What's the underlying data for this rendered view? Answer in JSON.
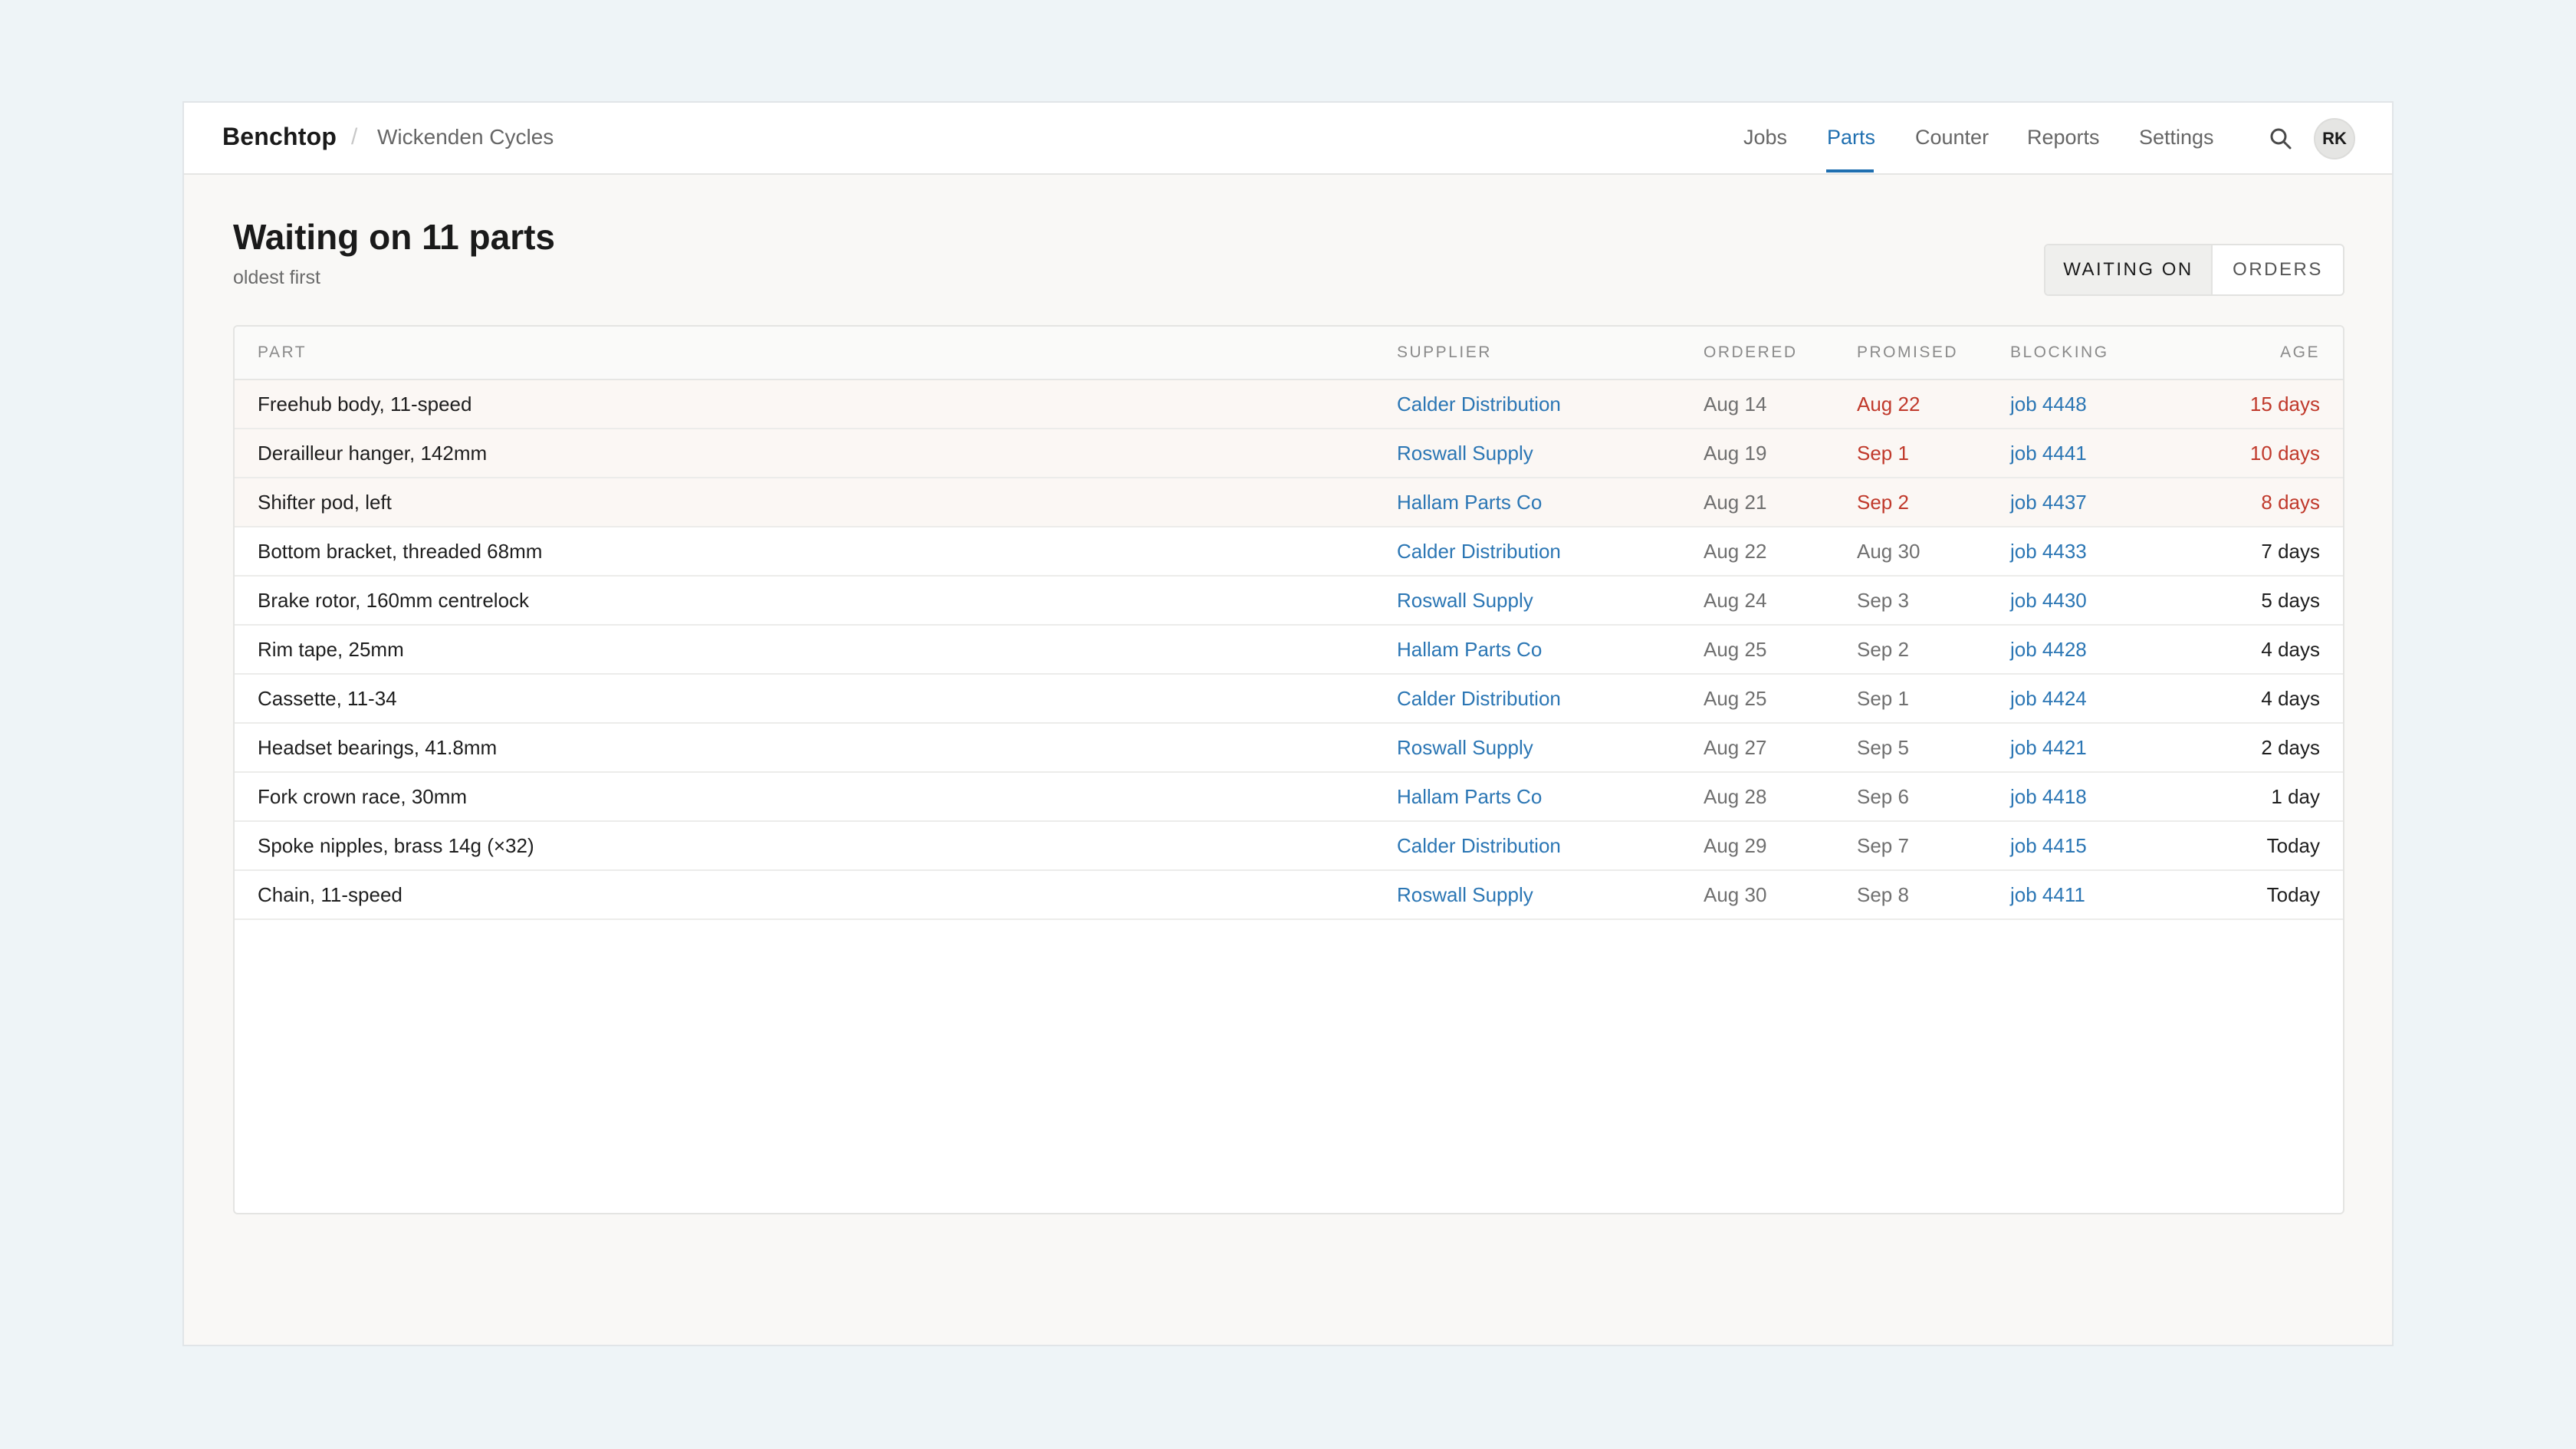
{
  "app": {
    "brand": "Benchtop",
    "separator": "/",
    "shop": "Wickenden Cycles"
  },
  "nav": {
    "items": [
      {
        "label": "Jobs"
      },
      {
        "label": "Parts",
        "active": true
      },
      {
        "label": "Counter"
      },
      {
        "label": "Reports"
      },
      {
        "label": "Settings"
      }
    ],
    "search_icon": "search-icon",
    "avatar_initials": "RK"
  },
  "page": {
    "title": "Waiting on 11 parts",
    "subtitle": "oldest first"
  },
  "view_toggle": {
    "selected": "WAITING ON",
    "options": [
      "WAITING ON",
      "ORDERS"
    ]
  },
  "table": {
    "columns": [
      "PART",
      "SUPPLIER",
      "ORDERED",
      "PROMISED",
      "BLOCKING",
      "AGE"
    ],
    "rows": [
      {
        "part": "Freehub body, 11-speed",
        "supplier": "Calder Distribution",
        "ordered": "Aug 14",
        "promised": "Aug 22",
        "blocking": "job 4448",
        "age": "15 days",
        "overdue": true
      },
      {
        "part": "Derailleur hanger, 142mm",
        "supplier": "Roswall Supply",
        "ordered": "Aug 19",
        "promised": "Sep 1",
        "blocking": "job 4441",
        "age": "10 days",
        "overdue": true
      },
      {
        "part": "Shifter pod, left",
        "supplier": "Hallam Parts Co",
        "ordered": "Aug 21",
        "promised": "Sep 2",
        "blocking": "job 4437",
        "age": "8 days",
        "overdue": true
      },
      {
        "part": "Bottom bracket, threaded 68mm",
        "supplier": "Calder Distribution",
        "ordered": "Aug 22",
        "promised": "Aug 30",
        "blocking": "job 4433",
        "age": "7 days",
        "overdue": false
      },
      {
        "part": "Brake rotor, 160mm centrelock",
        "supplier": "Roswall Supply",
        "ordered": "Aug 24",
        "promised": "Sep 3",
        "blocking": "job 4430",
        "age": "5 days",
        "overdue": false
      },
      {
        "part": "Rim tape, 25mm",
        "supplier": "Hallam Parts Co",
        "ordered": "Aug 25",
        "promised": "Sep 2",
        "blocking": "job 4428",
        "age": "4 days",
        "overdue": false
      },
      {
        "part": "Cassette, 11-34",
        "supplier": "Calder Distribution",
        "ordered": "Aug 25",
        "promised": "Sep 1",
        "blocking": "job 4424",
        "age": "4 days",
        "overdue": false
      },
      {
        "part": "Headset bearings, 41.8mm",
        "supplier": "Roswall Supply",
        "ordered": "Aug 27",
        "promised": "Sep 5",
        "blocking": "job 4421",
        "age": "2 days",
        "overdue": false
      },
      {
        "part": "Fork crown race, 30mm",
        "supplier": "Hallam Parts Co",
        "ordered": "Aug 28",
        "promised": "Sep 6",
        "blocking": "job 4418",
        "age": "1 day",
        "overdue": false
      },
      {
        "part": "Spoke nipples, brass 14g (×32)",
        "supplier": "Calder Distribution",
        "ordered": "Aug 29",
        "promised": "Sep 7",
        "blocking": "job 4415",
        "age": "Today",
        "overdue": false
      },
      {
        "part": "Chain, 11-speed",
        "supplier": "Roswall Supply",
        "ordered": "Aug 30",
        "promised": "Sep 8",
        "blocking": "job 4411",
        "age": "Today",
        "overdue": false
      }
    ]
  },
  "colors": {
    "accent": "#1f6fb0",
    "link": "#2b76b4",
    "overdue": "#c0392b",
    "overdue_row": "#fbf7f4"
  }
}
